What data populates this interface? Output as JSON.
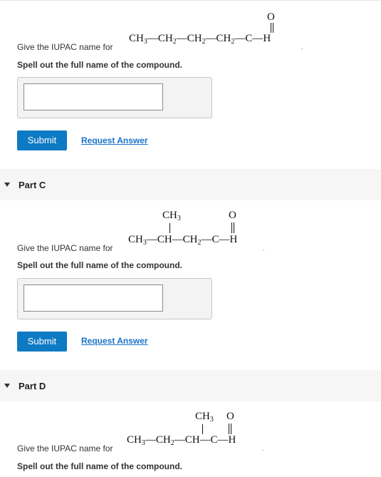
{
  "parts": [
    {
      "label": "",
      "prompt": "Give the IUPAC name for",
      "instruction": "Spell out the full name of the compound.",
      "formula": {
        "main": "CH3—CH2—CH2—CH2—C—H",
        "substituent_O": "O"
      },
      "submit_label": "Submit",
      "request_label": "Request Answer",
      "answer_value": ""
    },
    {
      "label": "Part C",
      "prompt": "Give the IUPAC name for",
      "instruction": "Spell out the full name of the compound.",
      "formula": {
        "main": "CH3—CH—CH2—C—H",
        "substituent_CH3": "CH3",
        "substituent_O": "O"
      },
      "submit_label": "Submit",
      "request_label": "Request Answer",
      "answer_value": ""
    },
    {
      "label": "Part D",
      "prompt": "Give the IUPAC name for",
      "instruction": "Spell out the full name of the compound.",
      "formula": {
        "main": "CH3—CH2—CH—C—H",
        "substituent_CH3": "CH3",
        "substituent_O": "O"
      }
    }
  ],
  "colors": {
    "accent": "#0e7ac3",
    "link": "#1a73c9",
    "part_header_bg": "#f6f6f6"
  },
  "icons": {
    "expand": "caret-down-icon"
  }
}
